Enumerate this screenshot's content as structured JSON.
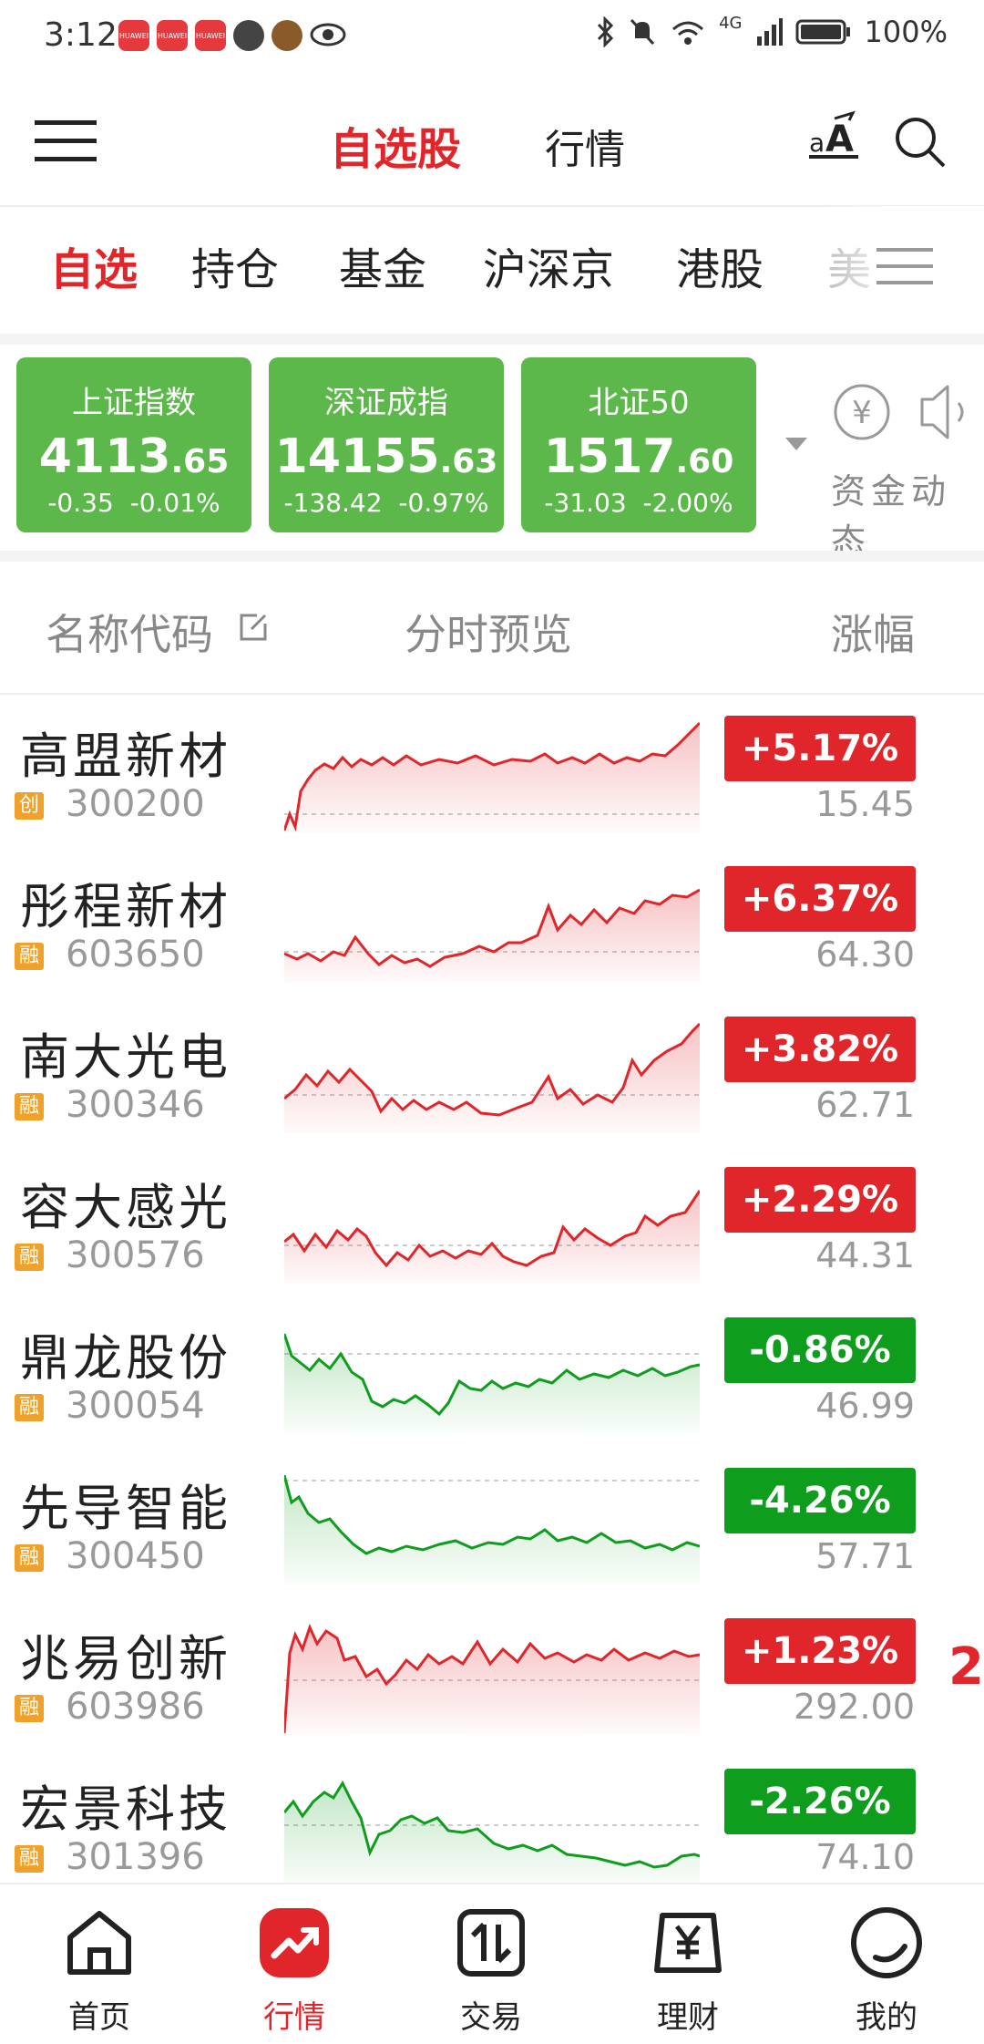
{
  "status_bar": {
    "time": "3:12",
    "battery": "100%",
    "network": "4G"
  },
  "header": {
    "tab_watchlist": "自选股",
    "tab_market": "行情"
  },
  "sub_tabs": [
    "自选",
    "持仓",
    "基金",
    "沪深京",
    "港股",
    "美"
  ],
  "indices": [
    {
      "name": "上证指数",
      "value_int": "4113",
      "value_dec": ".65",
      "change": "-0.35",
      "change_pct": "-0.01%"
    },
    {
      "name": "深证成指",
      "value_int": "14155",
      "value_dec": ".63",
      "change": "-138.42",
      "change_pct": "-0.97%"
    },
    {
      "name": "北证50",
      "value_int": "1517",
      "value_dec": ".60",
      "change": "-31.03",
      "change_pct": "-2.00%"
    }
  ],
  "fund_flow": {
    "label": "资金动态"
  },
  "columns": {
    "name_code": "名称代码",
    "preview": "分时预览",
    "change": "涨幅"
  },
  "stocks": [
    {
      "name": "高盟新材",
      "badge": "创",
      "code": "300200",
      "change": "+5.17%",
      "price": "15.45",
      "trend": "up"
    },
    {
      "name": "彤程新材",
      "badge": "融",
      "code": "603650",
      "change": "+6.37%",
      "price": "64.30",
      "trend": "up"
    },
    {
      "name": "南大光电",
      "badge": "融",
      "code": "300346",
      "change": "+3.82%",
      "price": "62.71",
      "trend": "up"
    },
    {
      "name": "容大感光",
      "badge": "融",
      "code": "300576",
      "change": "+2.29%",
      "price": "44.31",
      "trend": "up"
    },
    {
      "name": "鼎龙股份",
      "badge": "融",
      "code": "300054",
      "change": "-0.86%",
      "price": "46.99",
      "trend": "down"
    },
    {
      "name": "先导智能",
      "badge": "融",
      "code": "300450",
      "change": "-4.26%",
      "price": "57.71",
      "trend": "down"
    },
    {
      "name": "兆易创新",
      "badge": "融",
      "code": "603986",
      "change": "+1.23%",
      "price": "292.00",
      "trend": "up"
    },
    {
      "name": "宏景科技",
      "badge": "融",
      "code": "301396",
      "change": "-2.26%",
      "price": "74.10",
      "trend": "down"
    }
  ],
  "edge_fragment": "2",
  "bottom_nav": [
    "首页",
    "行情",
    "交易",
    "理财",
    "我的"
  ],
  "colors": {
    "accent": "#e0262a",
    "up": "#e0262a",
    "down": "#0f9d1e",
    "index_card": "#5cb84a",
    "badge": "#f0a12a"
  }
}
